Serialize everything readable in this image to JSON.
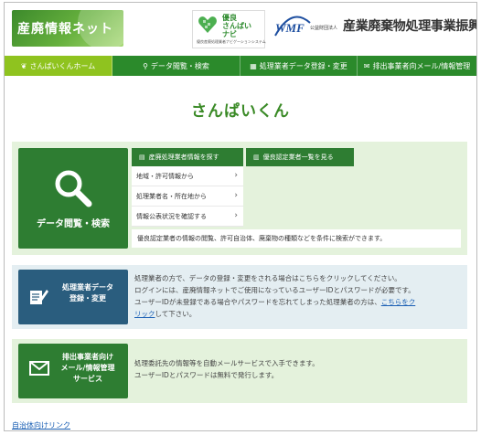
{
  "header": {
    "site_logo_text": "産廃情報ネット",
    "yuryo_logo_title": "優良\nさんぱい\nナビ",
    "yuryo_logo_sub": "優良産廃処理業者ナビゲーションシステム",
    "wmf_logo_text": "WMF",
    "foundation_prefix": "公益財団法人",
    "foundation_name": "産業廃棄物処理事業振興財団"
  },
  "nav": [
    {
      "label": "さんぱいくんホーム",
      "icon": "leaf-icon",
      "active": true
    },
    {
      "label": "データ閲覧・検索",
      "icon": "search-icon",
      "active": false
    },
    {
      "label": "処理業者データ登録・変更",
      "icon": "edit-icon",
      "active": false
    },
    {
      "label": "排出事業者向メール/情報管理",
      "icon": "mail-icon",
      "active": false
    }
  ],
  "page_title": "さんぱいくん",
  "search_section": {
    "tile_label": "データ閲覧・検索",
    "tab1": "産廃処理業者情報を探す",
    "tab2": "優良認定業者一覧を見る",
    "sub_items": [
      "地域・許可情報から",
      "処理業者名・所在地から",
      "情報公表状況を確認する"
    ],
    "description": "優良認定業者の情報の閲覧、許可自治体、廃棄物の種類などを条件に検索ができます。"
  },
  "register_section": {
    "tile_label_line1": "処理業者データ",
    "tile_label_line2": "登録・変更",
    "text_line1": "処理業者の方で、データの登録・変更をされる場合はこちらをクリックしてください。",
    "text_line2": "ログインには、産廃情報ネットでご使用になっているユーザーIDとパスワードが必要です。",
    "text_line3": "ユーザーIDが未登録である場合やパスワードを忘れてしまった処理業者の方は、",
    "link_text": "こちらをク",
    "text_line4_link": "リック",
    "text_line4": "して下さい。"
  },
  "mail_section": {
    "tile_label_line1": "排出事業者向け",
    "tile_label_line2": "メール/情報管理",
    "tile_label_line3": "サービス",
    "text_line1": "処理委託先の情報等を自動メールサービスで入手できます。",
    "text_line2": "ユーザーIDとパスワードは無料で発行します。"
  },
  "footer_link": "自治体向けリンク",
  "colors": {
    "nav_green": "#2b8a2b",
    "nav_active": "#8fc31f",
    "tile_green": "#2e7d32",
    "tile_blue": "#2a5d7e",
    "section_bg": "#e4f2dc",
    "title_green": "#3a8a26"
  }
}
